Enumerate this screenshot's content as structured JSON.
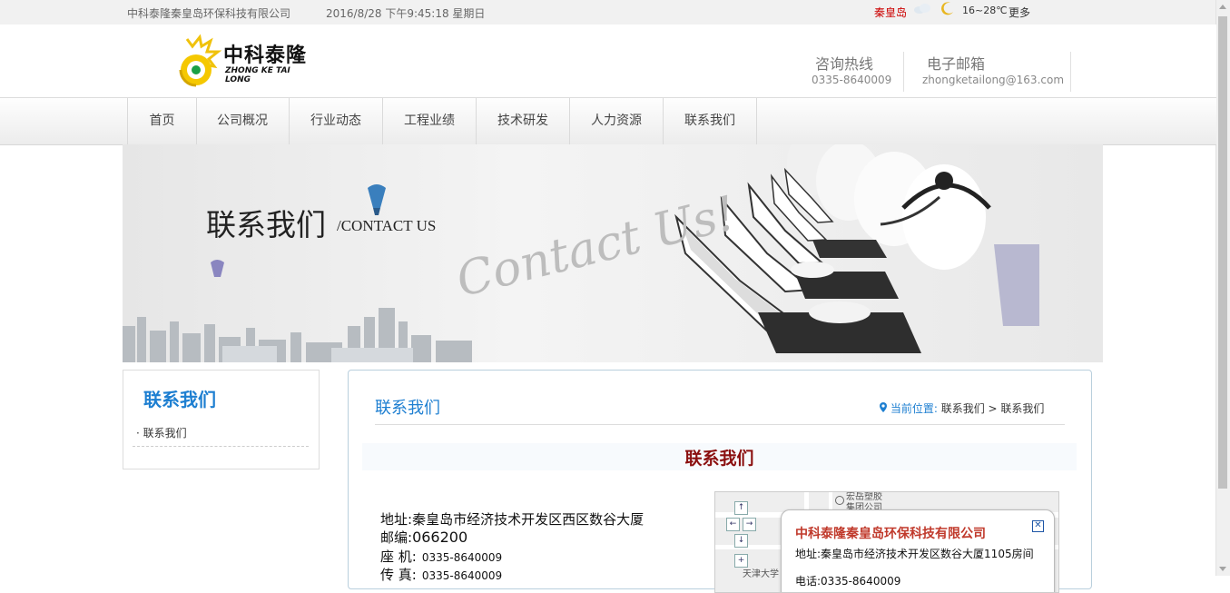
{
  "topbar": {
    "company": "中科泰隆秦皇岛环保科技有限公司",
    "datetime": "2016/8/28 下午9:45:18 星期日",
    "city": "秦皇岛",
    "temperature": "16~28℃",
    "more": "更多"
  },
  "header": {
    "logo_cn": "中科泰隆",
    "logo_en": "ZHONG KE TAI LONG",
    "hotline_label": "咨询热线",
    "hotline_value": "0335-8640009",
    "email_label": "电子邮箱",
    "email_value": "zhongketailong@163.com"
  },
  "nav": {
    "items": [
      "首页",
      "公司概况",
      "行业动态",
      "工程业绩",
      "技术研发",
      "人力资源",
      "联系我们"
    ]
  },
  "banner": {
    "title": "联系我们",
    "subtitle": "/CONTACT US",
    "script_text": "Contact Us!"
  },
  "sidebar": {
    "title": "联系我们",
    "items": [
      "联系我们"
    ]
  },
  "main": {
    "title": "联系我们",
    "breadcrumb_label": "当前位置:",
    "breadcrumb_path": "联系我们 > 联系我们",
    "section_title": "联系我们",
    "info": {
      "address_label": "地址:",
      "address": "秦皇岛市经济技术开发区西区数谷大厦",
      "postcode_label": "邮编:",
      "postcode": "066200",
      "phone_label": "座 机:",
      "phone": "0335-8640009",
      "fax_label": "传 真:",
      "fax": "0335-8640009"
    }
  },
  "map": {
    "poi": "宏岳塑胶集团公司",
    "label": "天津大学",
    "popup_title": "中科泰隆秦皇岛环保科技有限公司",
    "popup_address": "地址:秦皇岛市经济技术开发区数谷大厦1105房间",
    "popup_tel": "电话:0335-8640009"
  },
  "colors": {
    "accent_blue": "#1e7fd1",
    "title_red": "#8b1010",
    "city_red": "#cc0000"
  }
}
